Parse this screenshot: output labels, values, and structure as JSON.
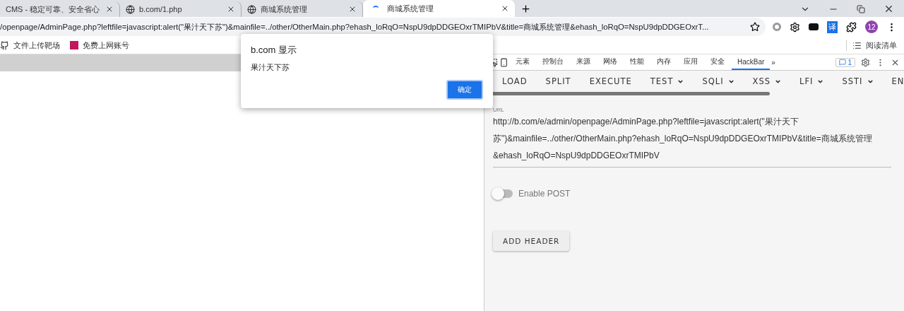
{
  "browser_tabs": [
    {
      "title": "CMS - 稳定可靠、安全省心",
      "selected": false,
      "loading": false
    },
    {
      "title": "b.com/1.php",
      "selected": false,
      "loading": false
    },
    {
      "title": "商城系统管理",
      "selected": false,
      "loading": false
    },
    {
      "title": "商城系统管理",
      "selected": true,
      "loading": true
    }
  ],
  "address_bar": {
    "value": "/openpage/AdminPage.php?leftfile=javascript:alert(\"果汁天下苏\")&mainfile=../other/OtherMain.php?ehash_loRqO=NspU9dpDDGEOxrTMIPbV&title=商城系统管理&ehash_loRqO=NspU9dpDDGEOxrT..."
  },
  "extensions": {
    "translate": "译",
    "profile": "12"
  },
  "bookmarks": [
    {
      "label": "文件上传靶场",
      "kind": "github"
    },
    {
      "label": "免费上网账号",
      "kind": "site"
    }
  ],
  "reading_list": "阅读清单",
  "dialog": {
    "title": "b.com 显示",
    "message": "果汁天下苏",
    "button": "确定"
  },
  "devtools": {
    "tabs": [
      {
        "label": "元素",
        "selected": false
      },
      {
        "label": "控制台",
        "selected": false
      },
      {
        "label": "来源",
        "selected": false
      },
      {
        "label": "网络",
        "selected": false
      },
      {
        "label": "性能",
        "selected": false
      },
      {
        "label": "内存",
        "selected": false
      },
      {
        "label": "应用",
        "selected": false
      },
      {
        "label": "安全",
        "selected": false
      },
      {
        "label": "HackBar",
        "selected": true
      }
    ],
    "more": "»",
    "issues": "1"
  },
  "hackbar": {
    "toolbar": [
      {
        "label": "LOAD",
        "kind": "button"
      },
      {
        "label": "SPLIT",
        "kind": "button"
      },
      {
        "label": "EXECUTE",
        "kind": "button"
      },
      {
        "label": "TEST",
        "kind": "menu"
      },
      {
        "label": "SQLI",
        "kind": "menu"
      },
      {
        "label": "XSS",
        "kind": "menu"
      },
      {
        "label": "LFI",
        "kind": "menu"
      },
      {
        "label": "SSTI",
        "kind": "menu"
      },
      {
        "label": "EN",
        "kind": "button"
      }
    ],
    "url_label": "URL",
    "url": "http://b.com/e/admin/openpage/AdminPage.php?leftfile=javascript:alert(\"果汁天下苏\")&mainfile=../other/OtherMain.php?ehash_loRqO=NspU9dpDDGEOxrTMIPbV&title=商城系统管理&ehash_loRqO=NspU9dpDDGEOxrTMIPbV",
    "enable_post": {
      "label": "Enable POST",
      "on": false
    },
    "add_header": "ADD HEADER"
  }
}
